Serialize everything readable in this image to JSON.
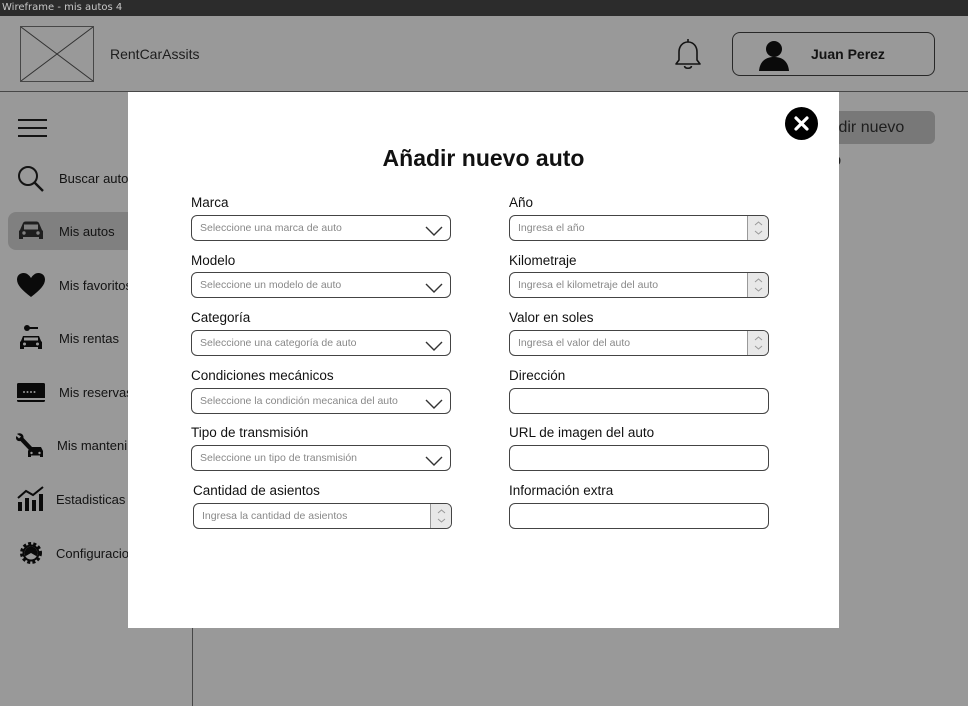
{
  "window": {
    "title": "Wireframe - mis autos 4"
  },
  "header": {
    "brand": "RentCarAssits",
    "logo_icon": "image-placeholder-icon",
    "notification_icon": "bell-icon",
    "user": {
      "name": "Juan Perez",
      "icon": "user-avatar-icon"
    }
  },
  "sidebar": {
    "menu_icon": "hamburger-menu-icon",
    "items": [
      {
        "label": "Buscar autos",
        "icon": "search-icon",
        "active": false
      },
      {
        "label": "Mis autos",
        "icon": "car-icon",
        "active": true
      },
      {
        "label": "Mis favoritos",
        "icon": "heart-icon",
        "active": false
      },
      {
        "label": "Mis rentas",
        "icon": "car-key-icon",
        "active": false
      },
      {
        "label": "Mis reservas",
        "icon": "card-icon",
        "active": false
      },
      {
        "label": "Mis mantenimientos",
        "icon": "wrench-car-icon",
        "active": false
      },
      {
        "label": "Estadisticas",
        "icon": "chart-icon",
        "active": false
      },
      {
        "label": "Configuracion",
        "icon": "gear-icon",
        "active": false
      }
    ]
  },
  "main": {
    "new_car_button": "Añadir nuevo auto"
  },
  "modal": {
    "title": "Añadir nuevo auto",
    "close_icon": "close-icon",
    "left_fields": [
      {
        "label": "Marca",
        "placeholder": "Seleccione una marca de auto",
        "type": "select"
      },
      {
        "label": "Modelo",
        "placeholder": "Seleccione un modelo de auto",
        "type": "select"
      },
      {
        "label": "Categoría",
        "placeholder": "Seleccione una categoría de auto",
        "type": "select"
      },
      {
        "label": "Condiciones mecánicos",
        "placeholder": "Seleccione la condición mecanica del auto",
        "type": "select"
      },
      {
        "label": "Tipo de transmisión",
        "placeholder": "Seleccione un tipo de transmisión",
        "type": "select"
      },
      {
        "label": "Cantidad de asientos",
        "placeholder": "Ingresa la cantidad de asientos",
        "type": "number"
      }
    ],
    "right_fields": [
      {
        "label": "Año",
        "placeholder": "Ingresa el año",
        "type": "number"
      },
      {
        "label": "Kilometraje",
        "placeholder": "Ingresa el kilometraje del auto",
        "type": "number"
      },
      {
        "label": "Valor en soles",
        "placeholder": "Ingresa el valor del auto",
        "type": "number"
      },
      {
        "label": "Dirección",
        "placeholder": "",
        "type": "text"
      },
      {
        "label": "URL de imagen del auto",
        "placeholder": "",
        "type": "text"
      },
      {
        "label": "Información extra",
        "placeholder": "",
        "type": "text"
      }
    ]
  }
}
